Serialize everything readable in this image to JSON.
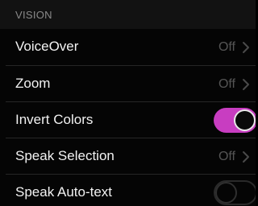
{
  "section": {
    "title": "VISION"
  },
  "colors": {
    "accent": "#c83dc1",
    "background": "#050505",
    "header_background": "#121212",
    "secondary_text": "#555555"
  },
  "rows": [
    {
      "label": "VoiceOver",
      "value": "Off",
      "control": "disclosure",
      "icon": "chevron-right-icon"
    },
    {
      "label": "Zoom",
      "value": "Off",
      "control": "disclosure",
      "icon": "chevron-right-icon"
    },
    {
      "label": "Invert Colors",
      "control": "toggle",
      "state": "on"
    },
    {
      "label": "Speak Selection",
      "value": "Off",
      "control": "disclosure",
      "icon": "chevron-right-icon"
    },
    {
      "label": "Speak Auto-text",
      "control": "toggle",
      "state": "off"
    }
  ]
}
